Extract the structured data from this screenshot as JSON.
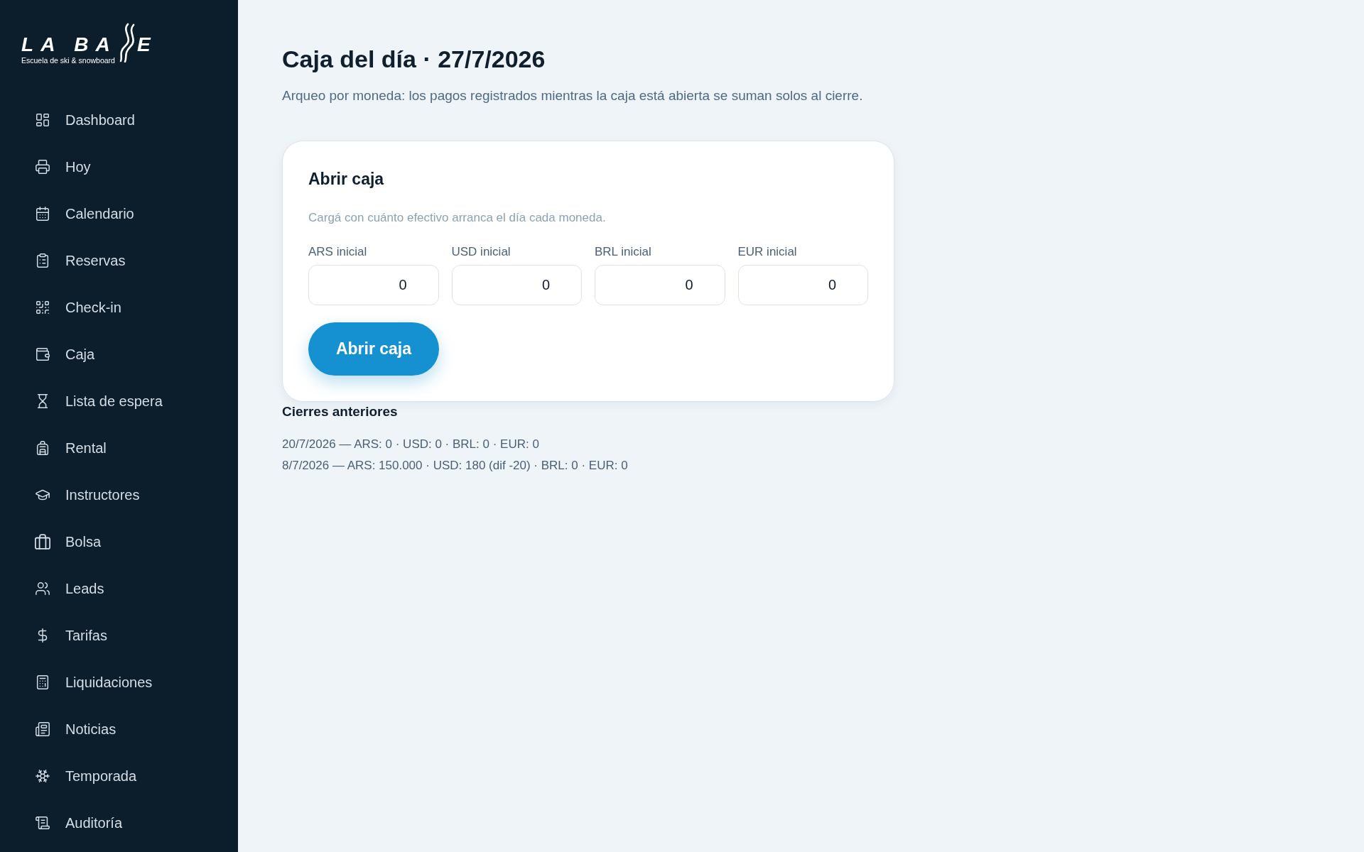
{
  "sidebar": {
    "logo": {
      "wordmark_start": "LA BA",
      "wordmark_end": "E",
      "tagline": "Escuela de ski & snowboard"
    },
    "items": [
      {
        "label": "Dashboard"
      },
      {
        "label": "Hoy"
      },
      {
        "label": "Calendario"
      },
      {
        "label": "Reservas"
      },
      {
        "label": "Check-in"
      },
      {
        "label": "Caja"
      },
      {
        "label": "Lista de espera"
      },
      {
        "label": "Rental"
      },
      {
        "label": "Instructores"
      },
      {
        "label": "Bolsa"
      },
      {
        "label": "Leads"
      },
      {
        "label": "Tarifas"
      },
      {
        "label": "Liquidaciones"
      },
      {
        "label": "Noticias"
      },
      {
        "label": "Temporada"
      },
      {
        "label": "Auditoría"
      }
    ]
  },
  "page": {
    "title": "Caja del día · 27/7/2026",
    "subtitle": "Arqueo por moneda: los pagos registrados mientras la caja está abierta se suman solos al cierre."
  },
  "open_cash_card": {
    "title": "Abrir caja",
    "hint": "Cargá con cuánto efectivo arranca el día cada moneda.",
    "fields": [
      {
        "label": "ARS inicial",
        "value": "0"
      },
      {
        "label": "USD inicial",
        "value": "0"
      },
      {
        "label": "BRL inicial",
        "value": "0"
      },
      {
        "label": "EUR inicial",
        "value": "0"
      }
    ],
    "button": "Abrir caja"
  },
  "previous_closings": {
    "title": "Cierres anteriores",
    "entries": [
      "20/7/2026 — ARS: 0 · USD: 0 · BRL: 0 · EUR: 0",
      "8/7/2026 — ARS: 150.000 · USD: 180 (dif -20) · BRL: 0 · EUR: 0"
    ]
  }
}
